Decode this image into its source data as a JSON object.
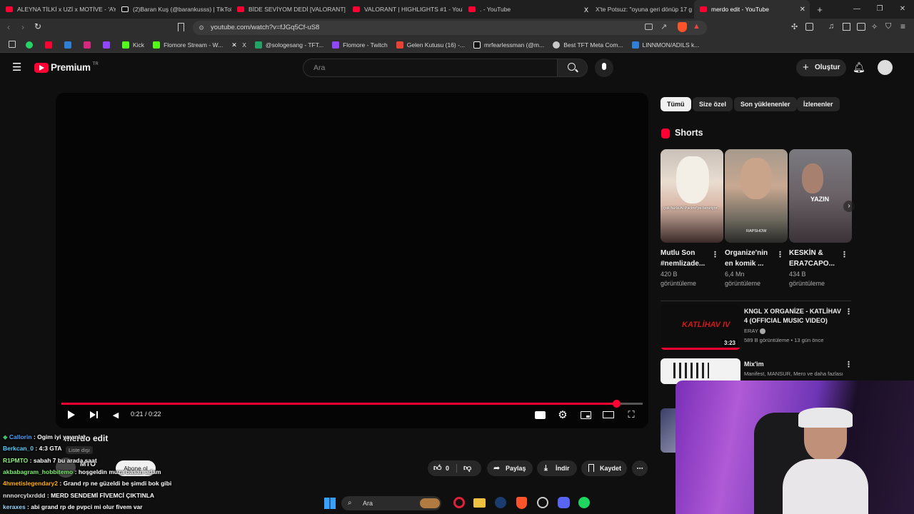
{
  "tabs": [
    {
      "title": "ALEYNA TİLKİ x UZİ x MOTİVE - 'AYRI",
      "favicon": "youtube-icon"
    },
    {
      "title": "(2)Baran Kuş (@barankusss) | TikTok",
      "favicon": "tiktok-icon"
    },
    {
      "title": "BİDE SEVİYOM DEDİ [VALORANT] - Y",
      "favicon": "youtube-icon"
    },
    {
      "title": "VALORANT | HIGHLIGHTS #1 - YouTu",
      "favicon": "youtube-icon"
    },
    {
      "title": ". - YouTube",
      "favicon": "youtube-icon"
    },
    {
      "title": "X'te Potsuz: \"oyuna geri dönüp 17 g",
      "favicon": "x-icon"
    },
    {
      "title": "merdo edit - YouTube",
      "favicon": "youtube-icon",
      "active": true
    }
  ],
  "address_bar": {
    "url": "youtube.com/watch?v=fJGq5Cf-uS8"
  },
  "bookmarks": [
    {
      "label": "",
      "icon": "whatsapp-icon",
      "color": "#25d366"
    },
    {
      "label": "",
      "icon": "youtube-icon",
      "color": "#ff0033"
    },
    {
      "label": "",
      "icon": "outlook-icon",
      "color": "#2f7fd6"
    },
    {
      "label": "",
      "icon": "instagram-icon",
      "color": "#d6287f"
    },
    {
      "label": "",
      "icon": "twitch-icon",
      "color": "#9146ff"
    },
    {
      "label": "Kick",
      "icon": "kick-icon",
      "color": "#53fc18"
    },
    {
      "label": "Flomore Stream - W...",
      "icon": "kick-icon",
      "color": "#53fc18"
    },
    {
      "label": "X",
      "icon": "x-icon",
      "color": "#ffffff"
    },
    {
      "label": "@sologesang - TFT...",
      "icon": "sheets-icon",
      "color": "#21a366"
    },
    {
      "label": "Flomore - Twitch",
      "icon": "twitch-icon",
      "color": "#9146ff"
    },
    {
      "label": "Gelen Kutusu (16) -...",
      "icon": "gmail-icon",
      "color": "#ea4335"
    },
    {
      "label": "mrfearlessman (@m...",
      "icon": "tiktok-icon",
      "color": "#ffffff"
    },
    {
      "label": "Best TFT Meta Com...",
      "icon": "tft-icon",
      "color": "#c8c8c8"
    },
    {
      "label": "LINNMON/ADILS k...",
      "icon": "ikea-icon",
      "color": "#2f7fd6"
    }
  ],
  "youtube": {
    "logo_text": "Premium",
    "logo_region": "TR",
    "search_placeholder": "Ara",
    "create_label": "Oluştur"
  },
  "player": {
    "time": "0:21 / 0:22",
    "progress": 0.9545,
    "video_title": "merdo edit",
    "channel": "MTO",
    "unlisted": "Liste dışı",
    "subscribe": "Abone ol",
    "likes": "0",
    "share": "Paylaş",
    "download": "İndir",
    "save": "Kaydet"
  },
  "chips": [
    {
      "label": "Tümü",
      "active": true
    },
    {
      "label": "Size özel"
    },
    {
      "label": "Son yüklenenler"
    },
    {
      "label": "İzlenenler"
    }
  ],
  "shorts": {
    "title": "Shorts",
    "items": [
      {
        "title_line1": "Mutlu Son",
        "title_line2": "#nemlizade...",
        "views_line1": "420 B",
        "views_line2": "görüntüleme",
        "caption": "çok fazla Al Pacino'ya benziyor..."
      },
      {
        "title_line1": "Organize'nin",
        "title_line2": "en komik ...",
        "views_line1": "6,4 Mn",
        "views_line2": "görüntüleme",
        "caption": "RAPSHOW"
      },
      {
        "title_line1": "KESKİN &",
        "title_line2": "ERA7CAPO...",
        "views_line1": "434 B",
        "views_line2": "görüntüleme",
        "caption": "YAZIN"
      }
    ]
  },
  "recommended": [
    {
      "title_line1": "KNGL X ORGANİZE - KATLİHAV",
      "title_line2": "4 (OFFICIAL MUSIC VIDEO)",
      "channel": "ERAY",
      "meta": "589 B görüntüleme • 13 gün önce",
      "duration": "3:23",
      "thumb_text": "KATLİHAV IV"
    },
    {
      "title_line1": "Mix'im",
      "title_line2": "",
      "channel": "Manifest, MANSUR, Mero ve daha fazlası",
      "meta": "",
      "duration": ""
    }
  ],
  "chat": [
    {
      "user": "Callorin",
      "msg": ": Ogim iyi yayınlar",
      "color": "#4ea0ff"
    },
    {
      "user": "Berkcan_0",
      "msg": ": 4:3 GTA",
      "color": "#5ad1ff"
    },
    {
      "user": "R1PMTO",
      "msg": ": sabah 7 bu arada saat",
      "color": "#8ef07a"
    },
    {
      "user": "akbabagram_hobbitemo",
      "msg": ": hoşgeldin muza basan adam",
      "color": "#7cf06b"
    },
    {
      "user": "4hmetislegendary2",
      "msg": ": Grand rp ne güzeldi be şimdi bok gibi",
      "color": "#ffb000"
    },
    {
      "user": "nnnorcylxrddd",
      "msg": ": MERD SENDEMİ FİVEMCİ ÇIKTINLA",
      "color": "#e0e0e0"
    },
    {
      "user": "keraxes",
      "msg": ": abi grand rp de pvpci mi olur fivem var",
      "color": "#9ad8ff"
    }
  ],
  "taskbar": {
    "search_placeholder": "Ara"
  }
}
